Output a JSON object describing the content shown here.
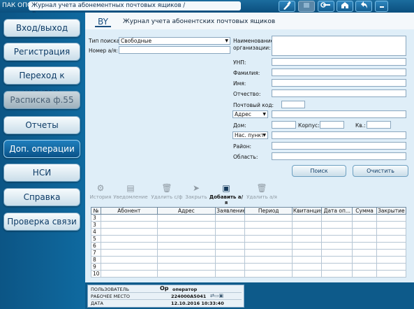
{
  "app_name": "ПАК ОПС",
  "breadcrumb": "Журнал учета абонементных почтовых ящиков / Дополнительные операции",
  "topbar_icons": [
    "broom-icon",
    "blank-icon",
    "wrench-icon",
    "home-icon",
    "back-icon",
    "minimize-icon"
  ],
  "sidebar": {
    "items": [
      {
        "label": "Вход/выход"
      },
      {
        "label": "Регистрация"
      },
      {
        "label": "Переход к услугам"
      },
      {
        "label": "Расписка ф.55"
      },
      {
        "label": "Отчеты"
      },
      {
        "label": "Доп. операции"
      },
      {
        "label": "НСИ"
      },
      {
        "label": "Справка"
      },
      {
        "label": "Проверка связи"
      }
    ]
  },
  "header": {
    "country_code": "BY",
    "title": "Журнал учета абонентских почтовых ящиков"
  },
  "form": {
    "search_type_label": "Тип поиска:",
    "search_type_value": "Свободные",
    "box_number_label": "Номер а/я:",
    "org_name_label_1": "Наименование",
    "org_name_label_2": "организации:",
    "unp_label": "УНП:",
    "lastname_label": "Фамилия:",
    "firstname_label": "Имя:",
    "patronymic_label": "Отчество:",
    "postcode_label": "Почтовый код:",
    "address_select": "Адрес",
    "house_label": "Дом:",
    "building_label": "Корпус:",
    "apartment_label": "Кв.:",
    "locality_select": "Нас. пункт",
    "district_label": "Район:",
    "region_label": "Область:",
    "search_button": "Поиск",
    "clear_button": "Очистить"
  },
  "toolbar": [
    {
      "label": "История",
      "icon": "gears-icon",
      "enabled": false
    },
    {
      "label": "Уведомление",
      "icon": "printer-icon",
      "enabled": false
    },
    {
      "label": "Удалить с/ф",
      "icon": "trash-icon",
      "enabled": false
    },
    {
      "label": "Закрыть",
      "icon": "arrow-icon",
      "enabled": false
    },
    {
      "label": "Добавить а/я",
      "icon": "add-box-icon",
      "enabled": true
    },
    {
      "label": "Удалить а/я",
      "icon": "trash-icon",
      "enabled": false
    }
  ],
  "table": {
    "columns": [
      "№",
      "Абонент",
      "Адрес",
      "Заявление",
      "Период",
      "Квитанция",
      "Дата оп...",
      "Сумма",
      "Закрытие"
    ],
    "row_numbers": [
      "3",
      "3",
      "4",
      "5",
      "6",
      "7",
      "8",
      "9",
      "10"
    ]
  },
  "status": {
    "user_label": "ПОЛЬЗОВАТЕЛЬ",
    "user_value": "оператор",
    "user_badge": "Oр",
    "workplace_label": "РАБОЧЕЕ МЕСТО",
    "workplace_value": "224000А5041",
    "date_label": "ДАТА",
    "date_value": "12.10.2016   10:33:40"
  },
  "colors": {
    "accent": "#0d5a8a",
    "active_nav": "#1f7fbd",
    "panel": "#dfeef8"
  }
}
